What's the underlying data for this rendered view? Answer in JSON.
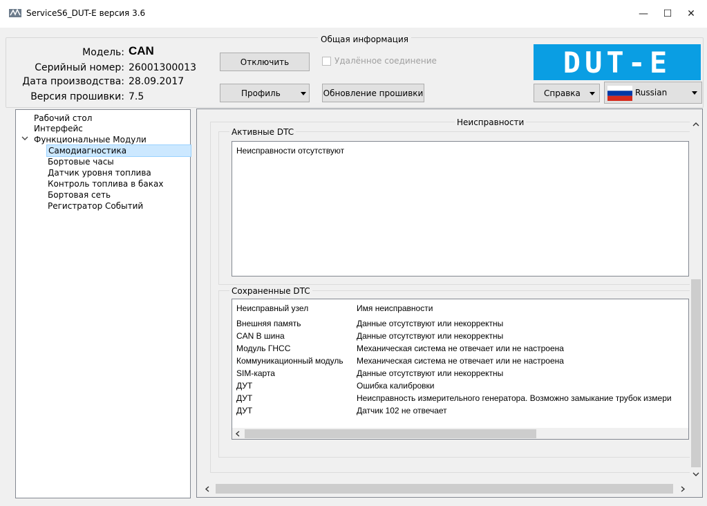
{
  "window": {
    "title": "ServiceS6_DUT-E версия 3.6",
    "minimize_glyph": "—",
    "maximize_glyph": "☐",
    "close_glyph": "✕"
  },
  "info": {
    "section_title": "Общая информация",
    "model_label": "Модель:",
    "model_value": "CAN",
    "serial_label": "Серийный номер:",
    "serial_value": "26001300013",
    "date_label": "Дата производства:",
    "date_value": "28.09.2017",
    "firmware_label": "Версия прошивки:",
    "firmware_value": "7.5",
    "disconnect_button": "Отключить",
    "remote_checkbox_label": "Удалённое соединение",
    "profile_button": "Профиль",
    "firmware_update_button": "Обновление прошивки",
    "logo_text": "DUT-E",
    "help_button": "Справка",
    "language_value": "Russian"
  },
  "tree": {
    "items": [
      {
        "label": "Рабочий стол"
      },
      {
        "label": "Интерфейс"
      },
      {
        "label": "Функциональные Модули"
      },
      {
        "label": "Самодиагностика"
      },
      {
        "label": "Бортовые часы"
      },
      {
        "label": "Датчик уровня топлива"
      },
      {
        "label": "Контроль топлива в баках"
      },
      {
        "label": "Бортовая сеть"
      },
      {
        "label": "Регистратор Событий"
      }
    ],
    "selected": "Самодиагностика"
  },
  "faults": {
    "section_title": "Неисправности",
    "active_title": "Активные DTC",
    "active_message": "Неисправности отсутствуют",
    "saved_title": "Сохраненные DTC",
    "columns": [
      "Неисправный узел",
      "Имя неисправности"
    ],
    "rows": [
      [
        "Внешняя память",
        "Данные отсутствуют или некорректны"
      ],
      [
        "CAN B шина",
        "Данные отсутствуют или некорректны"
      ],
      [
        "Модуль ГНСС",
        "Механическая система не отвечает или не настроена"
      ],
      [
        "Коммуникационный модуль",
        "Механическая система не отвечает или не настроена"
      ],
      [
        "SIM-карта",
        "Данные отсутствуют или некорректны"
      ],
      [
        "ДУТ",
        "Ошибка калибровки"
      ],
      [
        "ДУТ",
        "Неисправность измерительного генератора. Возможно замыкание трубок измери"
      ],
      [
        "ДУТ",
        "Датчик 102 не отвечает"
      ]
    ]
  },
  "colors": {
    "logo_bg": "#0a9ee3",
    "selection_bg": "#cce8ff",
    "flag_white": "#ffffff",
    "flag_blue": "#0039a6",
    "flag_red": "#d52b1e"
  }
}
